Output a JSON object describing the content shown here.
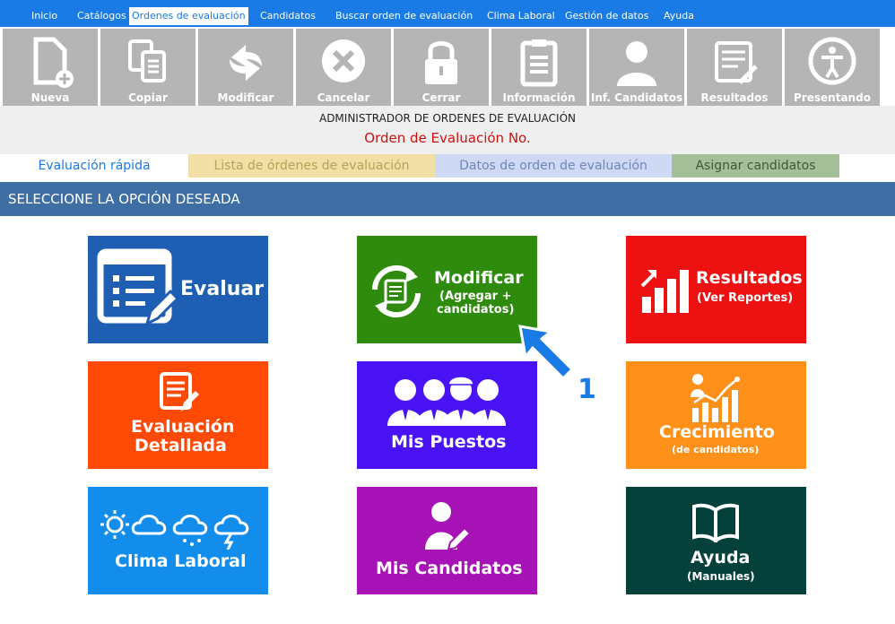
{
  "menu": [
    "Inicio",
    "Catálogos",
    "Ordenes de evaluación",
    "Candidatos",
    "Buscar orden de evaluación",
    "Clima Laboral",
    "Gestión de datos",
    "Ayuda"
  ],
  "toolbar": [
    "Nueva",
    "Copiar",
    "Modificar",
    "Cancelar",
    "Cerrar",
    "Información",
    "Inf. Candidatos",
    "Resultados",
    "Presentando"
  ],
  "header": {
    "admin": "ADMINISTRADOR DE ORDENES DE EVALUACIÓN",
    "orden": "Orden de Evaluación No."
  },
  "tabs": [
    "Evaluación rápida",
    "Lista de órdenes de evaluación",
    "Datos de orden de evaluación",
    "Asignar candidatos"
  ],
  "section_title": "SELECCIONE LA OPCIÓN DESEADA",
  "tiles": {
    "evaluar": {
      "title": "Evaluar",
      "color": "#1e5fb3"
    },
    "modificar": {
      "title": "Modificar",
      "sub1": "(Agregar +",
      "sub2": "candidatos)",
      "color": "#2e8b0e"
    },
    "resultados": {
      "title": "Resultados",
      "sub": "(Ver Reportes)",
      "color": "#ee1111"
    },
    "evaluacion_detallada": {
      "title1": "Evaluación",
      "title2": "Detallada",
      "color": "#ff4a06"
    },
    "mis_puestos": {
      "title": "Mis Puestos",
      "color": "#4a13f5"
    },
    "crecimiento": {
      "title": "Crecimiento",
      "sub": "(de candidatos)",
      "color": "#ff9019"
    },
    "clima_laboral": {
      "title": "Clima Laboral",
      "color": "#138dec"
    },
    "mis_candidatos": {
      "title": "Mis Candidatos",
      "color": "#a712b6"
    },
    "ayuda": {
      "title": "Ayuda",
      "sub": "(Manuales)",
      "color": "#05413b"
    }
  },
  "annotation_number": "1"
}
